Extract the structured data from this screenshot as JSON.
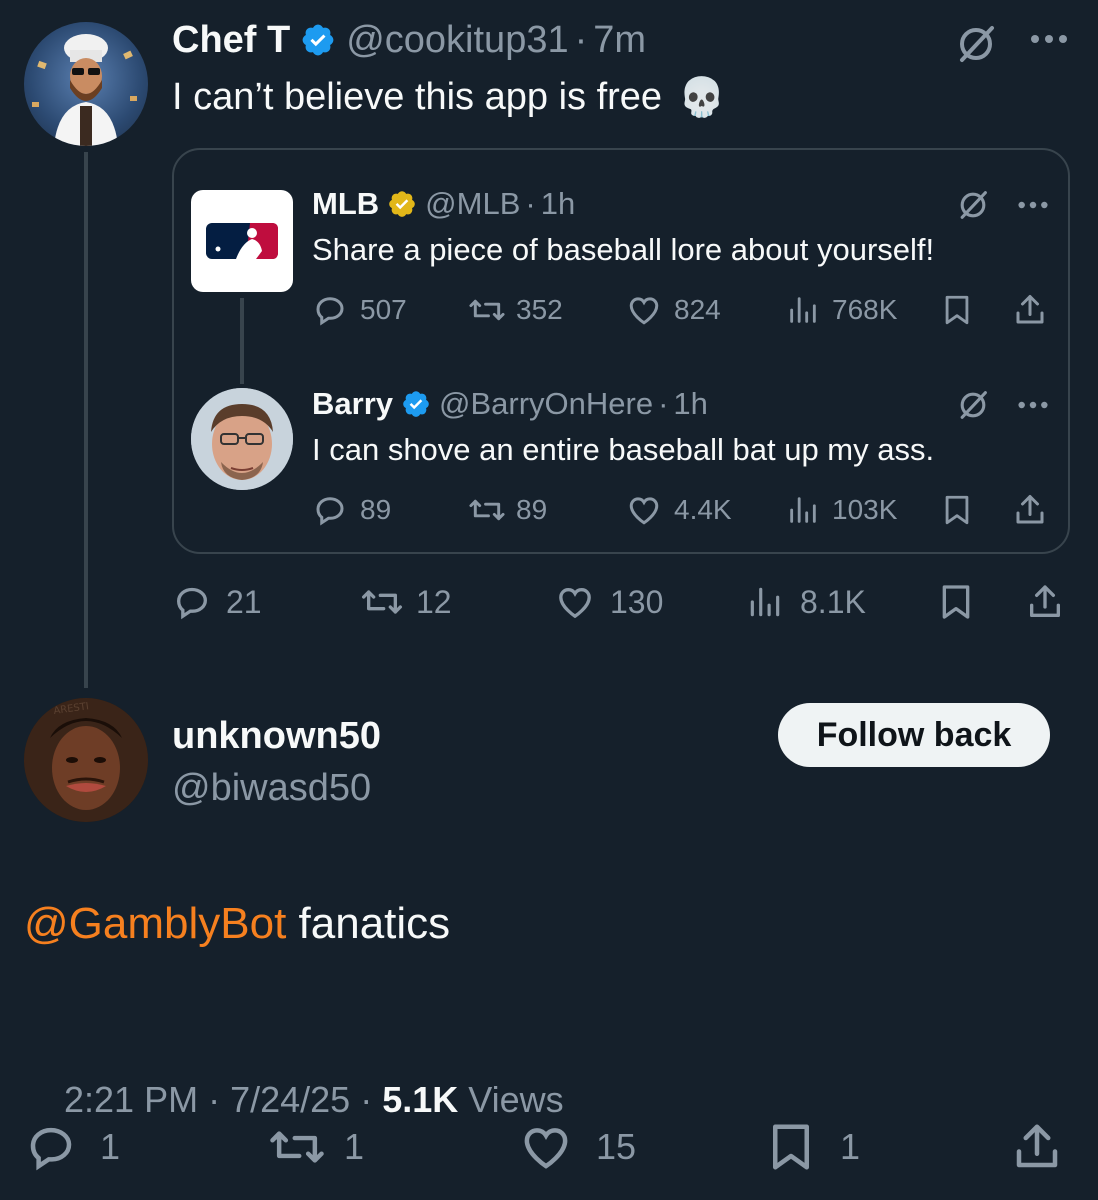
{
  "parent_post": {
    "display_name": "Chef T",
    "handle": "@cookitup31",
    "time": "7m",
    "separator": "·",
    "text": "I can’t believe this app is free",
    "emoji": "💀",
    "stats": {
      "replies": "21",
      "reposts": "12",
      "likes": "130",
      "views": "8.1K"
    }
  },
  "quoted_thread": {
    "mlb": {
      "display_name": "MLB",
      "handle": "@MLB",
      "time": "1h",
      "separator": "·",
      "text": "Share a piece of baseball lore about yourself!",
      "stats": {
        "replies": "507",
        "reposts": "352",
        "likes": "824",
        "views": "768K"
      }
    },
    "barry": {
      "display_name": "Barry",
      "handle": "@BarryOnHere",
      "time": "1h",
      "separator": "·",
      "text": "I can shove an entire baseball bat up my ass.",
      "stats": {
        "replies": "89",
        "reposts": "89",
        "likes": "4.4K",
        "views": "103K"
      }
    }
  },
  "main_post": {
    "display_name": "unknown50",
    "handle": "@biwasd50",
    "follow_button": "Follow back",
    "mention": "@GamblyBot",
    "text": " fanatics",
    "timestamp": "2:21 PM · 7/24/25 · ",
    "views_count": "5.1K",
    "views_label": " Views",
    "stats": {
      "replies": "1",
      "reposts": "1",
      "likes": "15",
      "bookmarks": "1"
    }
  },
  "colors": {
    "background": "#15202b",
    "text_primary": "#f7f9f9",
    "text_secondary": "#8b98a5",
    "verified_blue": "#1d9bf0",
    "verified_gold": "#e2b719",
    "mention": "#f6801f",
    "border": "#38444d"
  },
  "icons": [
    "grok-icon",
    "more-icon",
    "reply-icon",
    "repost-icon",
    "like-icon",
    "views-icon",
    "bookmark-icon",
    "share-icon",
    "verified-badge-icon",
    "mlb-logo"
  ]
}
